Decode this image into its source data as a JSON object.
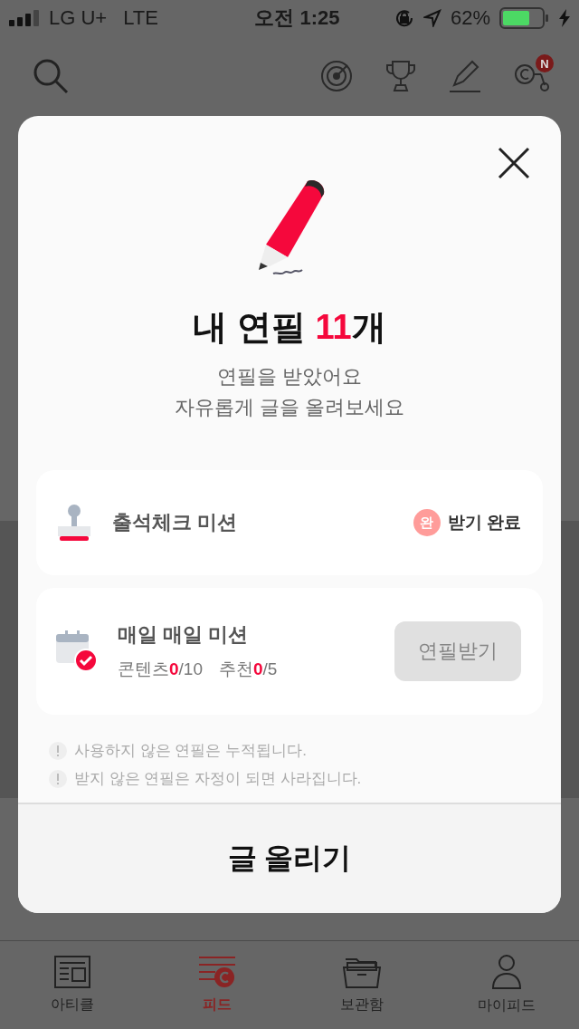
{
  "status_bar": {
    "carrier": "LG U+",
    "network": "LTE",
    "time": "오전 1:25",
    "battery": "62%"
  },
  "header": {
    "badge": "N"
  },
  "dialog": {
    "title": {
      "text": "내 연필 ",
      "count": "11",
      "unit": "개"
    },
    "subtitle": [
      "연필을 받았어요",
      "자유롭게 글을 올려보세요"
    ],
    "missions": [
      {
        "kind": "completed",
        "title": "출석체크 미션",
        "badge": "완",
        "status": "받기 완료"
      },
      {
        "kind": "claim",
        "title": "매일 매일 미션",
        "progress": [
          {
            "label": "콘텐츠",
            "done": "0",
            "total": "/10"
          },
          {
            "label": "추천",
            "done": "0",
            "total": "/5"
          }
        ],
        "button": "연필받기",
        "disabled": true
      }
    ],
    "notes": [
      "사용하지 않은 연필은 누적됩니다.",
      "받지 않은 연필은 자정이 되면 사라집니다."
    ],
    "action": "글 올리기"
  },
  "tab_bar": [
    {
      "label": "아티클",
      "selected": false
    },
    {
      "label": "피드",
      "selected": true
    },
    {
      "label": "보관함",
      "selected": false
    },
    {
      "label": "마이피드",
      "selected": false
    }
  ]
}
